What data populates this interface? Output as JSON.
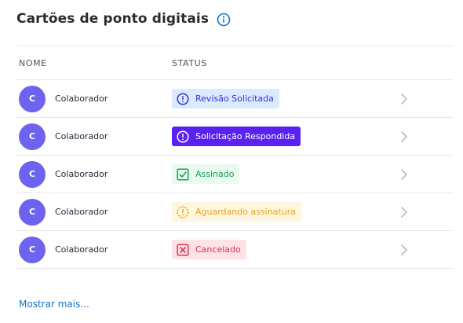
{
  "header": {
    "title": "Cartões de ponto digitais",
    "info_icon": "info-icon"
  },
  "table": {
    "columns": [
      "NOME",
      "STATUS"
    ],
    "rows": [
      {
        "avatar": "C",
        "name": "Colaborador",
        "status": "Revisão Solicitada",
        "status_icon": "exclamation-circle-icon",
        "badge_bg": "#dbeafe",
        "badge_fg": "#3b2fd6"
      },
      {
        "avatar": "C",
        "name": "Colaborador",
        "status": "Solicitação Respondida",
        "status_icon": "exclamation-circle-icon",
        "badge_bg": "#5b21f0",
        "badge_fg": "#ffffff"
      },
      {
        "avatar": "C",
        "name": "Colaborador",
        "status": "Assinado",
        "status_icon": "check-square-icon",
        "badge_bg": "#eafaf0",
        "badge_fg": "#18a14a"
      },
      {
        "avatar": "C",
        "name": "Colaborador",
        "status": "Aguardando assinatura",
        "status_icon": "dashed-clock-icon",
        "badge_bg": "#fff6df",
        "badge_fg": "#e6a21a"
      },
      {
        "avatar": "C",
        "name": "Colaborador",
        "status": "Cancelado",
        "status_icon": "x-square-icon",
        "badge_bg": "#fde2e6",
        "badge_fg": "#d9344a"
      }
    ]
  },
  "footer": {
    "more_link": "Mostrar mais..."
  },
  "colors": {
    "avatar_bg": "#6d63ee",
    "link": "#1a73c8",
    "divider": "#e5e7eb"
  }
}
